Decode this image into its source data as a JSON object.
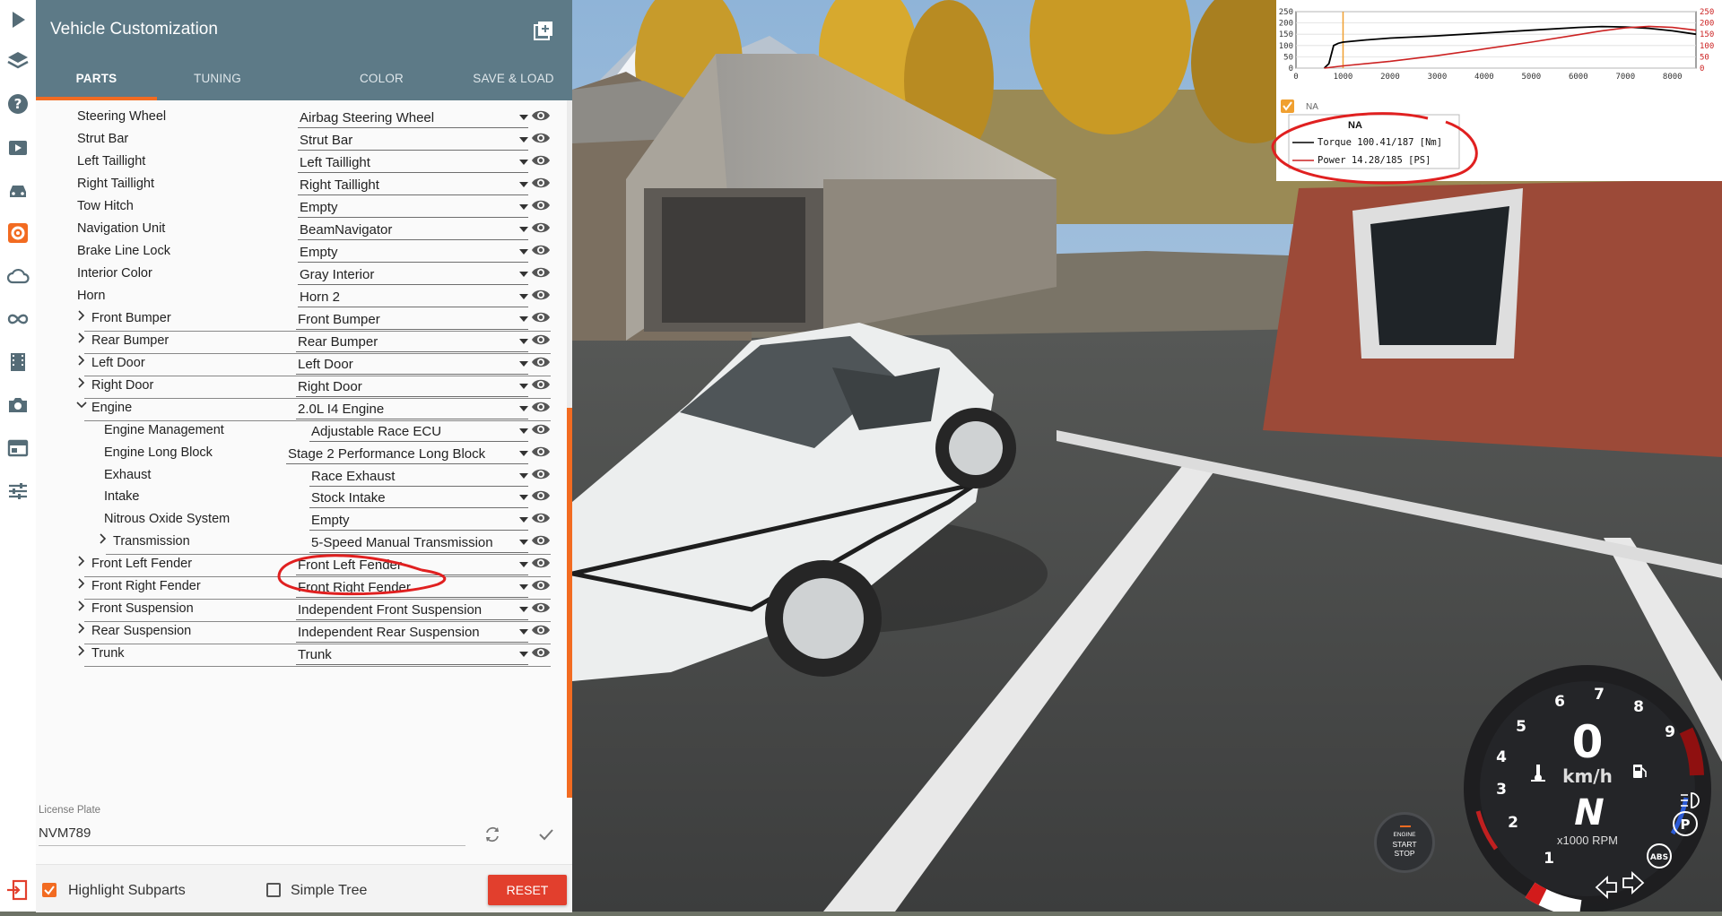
{
  "panel": {
    "title": "Vehicle Customization",
    "tabs": [
      {
        "label": "PARTS",
        "active": true
      },
      {
        "label": "TUNING",
        "active": false
      },
      {
        "label": "COLOR",
        "active": false
      },
      {
        "label": "SAVE & LOAD",
        "active": false
      }
    ],
    "accent_color": "#f26b21",
    "header_color": "#5d7a87"
  },
  "rail": {
    "icons": [
      "play-icon",
      "layers-icon",
      "help-icon",
      "scenario-icon",
      "vehicle-icon",
      "gear-icon",
      "cloud-icon",
      "infinity-icon",
      "film-icon",
      "camera-icon",
      "ui-apps-icon",
      "sliders-icon"
    ],
    "active": "gear-icon"
  },
  "parts": [
    {
      "label": "Steering Wheel",
      "value": "Airbag Steering Wheel",
      "level": 0,
      "expandable": false
    },
    {
      "label": "Strut Bar",
      "value": "Strut Bar",
      "level": 0,
      "expandable": false
    },
    {
      "label": "Left Taillight",
      "value": "Left Taillight",
      "level": 0,
      "expandable": false
    },
    {
      "label": "Right Taillight",
      "value": "Right Taillight",
      "level": 0,
      "expandable": false
    },
    {
      "label": "Tow Hitch",
      "value": "Empty",
      "level": 0,
      "expandable": false
    },
    {
      "label": "Navigation Unit",
      "value": "BeamNavigator",
      "level": 0,
      "expandable": false
    },
    {
      "label": "Brake Line Lock",
      "value": "Empty",
      "level": 0,
      "expandable": false
    },
    {
      "label": "Interior Color",
      "value": "Gray Interior",
      "level": 0,
      "expandable": false
    },
    {
      "label": "Horn",
      "value": "Horn 2",
      "level": 0,
      "expandable": false
    },
    {
      "label": "Front Bumper",
      "value": "Front Bumper",
      "level": 0,
      "expandable": true,
      "expanded": false
    },
    {
      "label": "Rear Bumper",
      "value": "Rear Bumper",
      "level": 0,
      "expandable": true,
      "expanded": false
    },
    {
      "label": "Left Door",
      "value": "Left Door",
      "level": 0,
      "expandable": true,
      "expanded": false
    },
    {
      "label": "Right Door",
      "value": "Right Door",
      "level": 0,
      "expandable": true,
      "expanded": false
    },
    {
      "label": "Engine",
      "value": "2.0L I4 Engine",
      "level": 0,
      "expandable": true,
      "expanded": true
    },
    {
      "label": "Engine Management",
      "value": "Adjustable Race ECU",
      "level": 1,
      "expandable": false
    },
    {
      "label": "Engine Long Block",
      "value": "Stage 2 Performance Long Block",
      "level": 1,
      "expandable": false
    },
    {
      "label": "Exhaust",
      "value": "Race Exhaust",
      "level": 1,
      "expandable": false
    },
    {
      "label": "Intake",
      "value": "Stock Intake",
      "level": 1,
      "expandable": false
    },
    {
      "label": "Nitrous Oxide System",
      "value": "Empty",
      "level": 1,
      "expandable": false
    },
    {
      "label": "Transmission",
      "value": "5-Speed Manual Transmission",
      "level": 1,
      "expandable": true,
      "expanded": false
    },
    {
      "label": "Front Left Fender",
      "value": "Front Left Fender",
      "level": 0,
      "expandable": true,
      "expanded": false
    },
    {
      "label": "Front Right Fender",
      "value": "Front Right Fender",
      "level": 0,
      "expandable": true,
      "expanded": false
    },
    {
      "label": "Front Suspension",
      "value": "Independent Front Suspension",
      "level": 0,
      "expandable": true,
      "expanded": false
    },
    {
      "label": "Rear Suspension",
      "value": "Independent Rear Suspension",
      "level": 0,
      "expandable": true,
      "expanded": false
    },
    {
      "label": "Trunk",
      "value": "Trunk",
      "level": 0,
      "expandable": true,
      "expanded": false
    }
  ],
  "license_plate": {
    "label": "License Plate",
    "value": "NVM789"
  },
  "footer": {
    "highlight_subparts": {
      "label": "Highlight Subparts",
      "checked": true
    },
    "simple_tree": {
      "label": "Simple Tree",
      "checked": false
    },
    "reset_label": "RESET"
  },
  "graph": {
    "y_ticks_left": [
      "250",
      "200",
      "150",
      "100",
      "50",
      "0"
    ],
    "y_ticks_right": [
      "250",
      "200",
      "150",
      "100",
      "50",
      "0"
    ],
    "x_ticks": [
      "0",
      "1000",
      "2000",
      "3000",
      "4000",
      "5000",
      "6000",
      "7000",
      "8000"
    ],
    "checkbox_label": "NA",
    "legend_title": "NA",
    "torque_text": "Torque 100.41/187 [Nm]",
    "power_text": "Power  14.28/185  [PS]",
    "torque_color": "#000000",
    "power_color": "#cc2222",
    "marker_color": "#f0a030"
  },
  "hud": {
    "speed": "0",
    "speed_unit": "km/h",
    "gear": "N",
    "rpm_unit": "x1000 RPM",
    "rpm_ticks": [
      "1",
      "2",
      "3",
      "4",
      "5",
      "6",
      "7",
      "8",
      "9"
    ],
    "engine_button": [
      "ENGINE",
      "START",
      "STOP"
    ],
    "abs_label": "ABS",
    "parking_label": "P"
  }
}
